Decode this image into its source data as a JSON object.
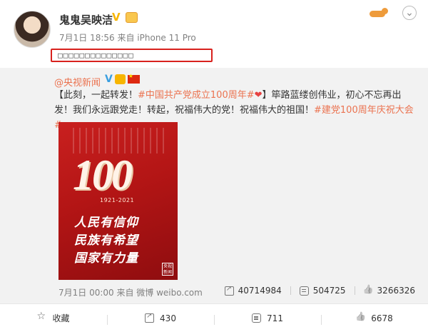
{
  "post": {
    "username": "鬼鬼吴映洁",
    "verified_mark": "V",
    "meta": "7月1日 18:56 来自 iPhone 11 Pro",
    "highlighted_text": "□□□□□□□□□□□□□□"
  },
  "repost": {
    "username": "@央视新闻",
    "verified_mark": "V",
    "text_intro": "【此刻，一起转发！",
    "tag1": "#中国共产党成立100周年#",
    "heart": "❤",
    "text_mid": "】筚路蓝缕创伟业，初心不忘再出发！我们永远跟党走！转起，祝福伟大的党！祝福伟大的祖国！",
    "tag2": "#建党100周年庆祝大会#",
    "poster": {
      "number": "100",
      "years": "1921-2021",
      "line1": "人民有信仰",
      "line2": "民族有希望",
      "line3": "国家有力量",
      "logo": "央视新闻"
    },
    "meta": "7月1日 00:00 来自 微博 weibo.com",
    "shares": "40714984",
    "comments": "504725",
    "likes": "3266326"
  },
  "actions": {
    "favorite": "收藏",
    "repost_count": "430",
    "comment_count": "711",
    "like_count": "6678"
  },
  "colors": {
    "accent": "#eb7350",
    "verified": "#f7b500",
    "highlight_border": "#d8211d"
  }
}
